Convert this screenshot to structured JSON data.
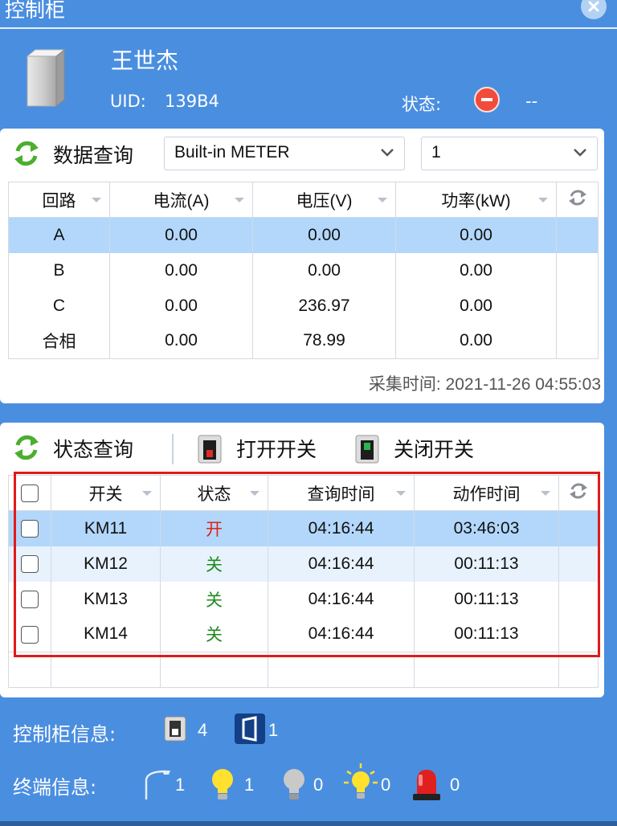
{
  "window": {
    "title": "控制柜"
  },
  "cabinet": {
    "name": "王世杰",
    "uid_label": "UID:",
    "uid_value": "139B4",
    "status_label": "状态:",
    "status_value": "--"
  },
  "data_query": {
    "title": "数据查询",
    "meter_select": "Built-in METER",
    "index_select": "1",
    "columns": [
      "回路",
      "电流(A)",
      "电压(V)",
      "功率(kW)"
    ],
    "rows": [
      [
        "A",
        "0.00",
        "0.00",
        "0.00"
      ],
      [
        "B",
        "0.00",
        "0.00",
        "0.00"
      ],
      [
        "C",
        "0.00",
        "236.97",
        "0.00"
      ],
      [
        "合相",
        "0.00",
        "78.99",
        "0.00"
      ]
    ],
    "collect_time": "采集时间: 2021-11-26 04:55:03"
  },
  "status_query": {
    "title": "状态查询",
    "open_label": "打开开关",
    "close_label": "关闭开关",
    "columns": [
      "开关",
      "状态",
      "查询时间",
      "动作时间"
    ],
    "rows": [
      [
        "KM11",
        "开",
        "04:16:44",
        "03:46:03"
      ],
      [
        "KM12",
        "关",
        "04:16:44",
        "00:11:13"
      ],
      [
        "KM13",
        "关",
        "04:16:44",
        "00:11:13"
      ],
      [
        "KM14",
        "关",
        "04:16:44",
        "00:11:13"
      ]
    ]
  },
  "cabinet_info": {
    "label": "控制柜信息:",
    "switch_count": "4",
    "door_count": "1"
  },
  "terminal_info": {
    "label": "终端信息:",
    "lamp_pole_count": "1",
    "lamp_on_count": "1",
    "lamp_off_count": "0",
    "lamp_bright_count": "0",
    "alarm_count": "0"
  },
  "colors": {
    "background": "#4a8ee0",
    "selected_row": "#b2d7fb",
    "status_on": "#e0201a",
    "status_off": "#1f8a1f",
    "highlight_frame": "#e01a1a"
  }
}
